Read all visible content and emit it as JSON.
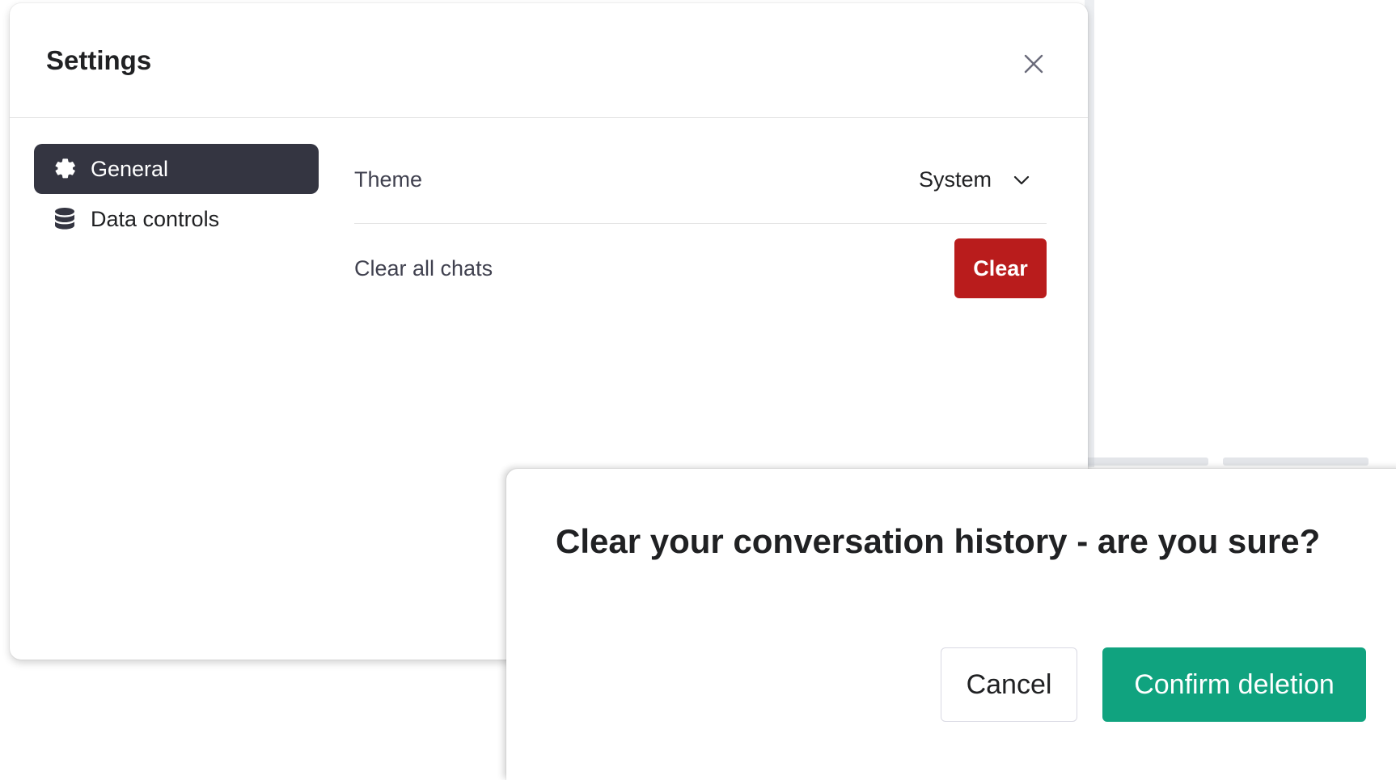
{
  "settings": {
    "title": "Settings",
    "nav": [
      {
        "label": "General",
        "icon": "gear-icon",
        "active": true
      },
      {
        "label": "Data controls",
        "icon": "database-icon",
        "active": false
      }
    ],
    "theme": {
      "label": "Theme",
      "value": "System"
    },
    "clear_chats": {
      "label": "Clear all chats",
      "button": "Clear"
    }
  },
  "confirm": {
    "title": "Clear your conversation history - are you sure?",
    "cancel_label": "Cancel",
    "confirm_label": "Confirm deletion"
  },
  "colors": {
    "nav_active_bg": "#343541",
    "danger": "#b91c1c",
    "confirm": "#10a37f"
  }
}
